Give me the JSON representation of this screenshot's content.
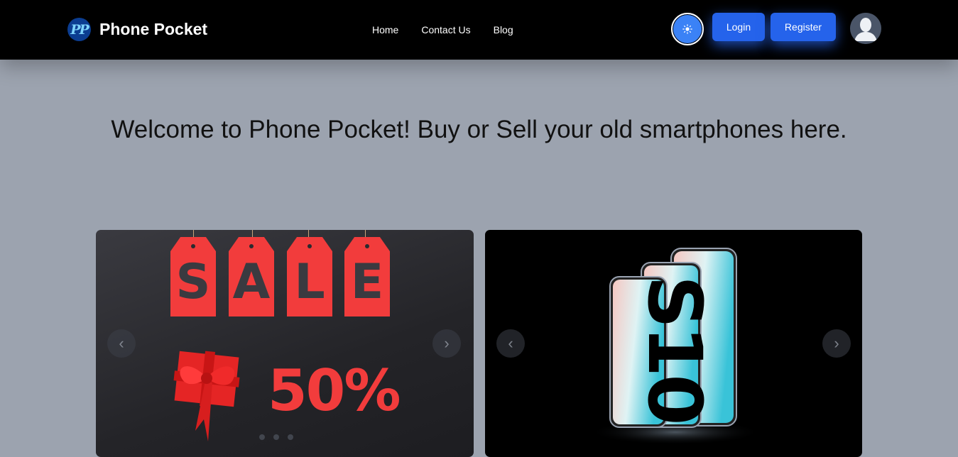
{
  "brand": {
    "logo_text": "PP",
    "name": "Phone Pocket"
  },
  "nav": {
    "links": [
      "Home",
      "Contact Us",
      "Blog"
    ]
  },
  "header_actions": {
    "theme_icon": "sun-icon",
    "login_label": "Login",
    "register_label": "Register",
    "avatar_icon": "user-avatar-icon"
  },
  "hero": {
    "title": "Welcome to Phone Pocket! Buy or Sell your old smartphones here."
  },
  "carousel_1": {
    "sale_letters": [
      "S",
      "A",
      "L",
      "E"
    ],
    "discount": "50%",
    "prev_icon": "chevron-left-icon",
    "next_icon": "chevron-right-icon"
  },
  "carousel_2": {
    "phone_text": "S10",
    "prev_icon": "chevron-left-icon",
    "next_icon": "chevron-right-icon"
  },
  "colors": {
    "accent": "#2563eb",
    "sale_red": "#f23c3c",
    "page_bg": "#9ca3af",
    "nav_bg": "#000000"
  }
}
